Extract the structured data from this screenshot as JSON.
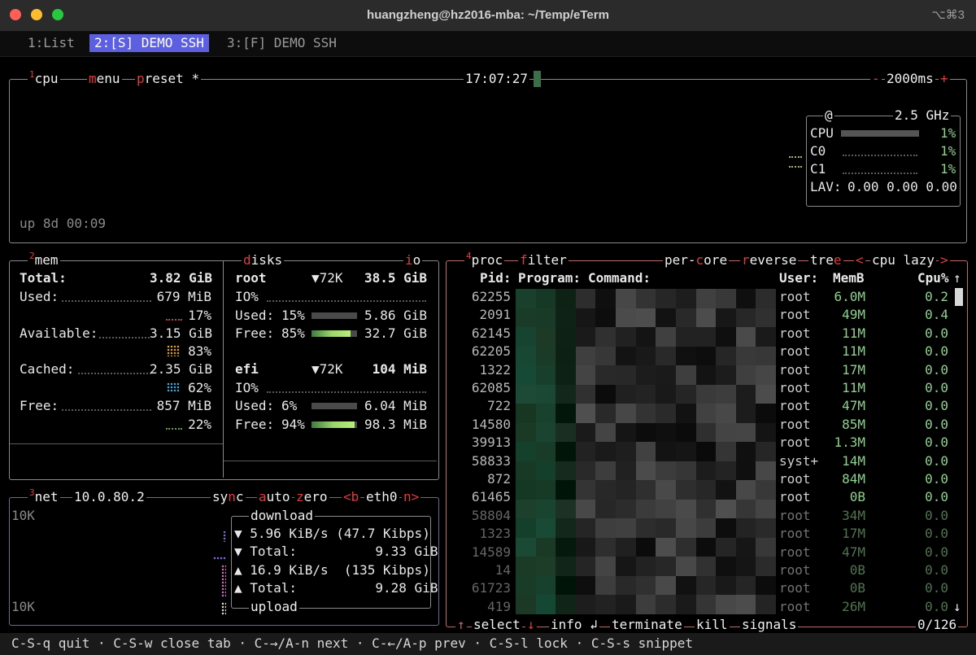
{
  "window": {
    "title": "huangzheng@hz2016-mba: ~/Temp/eTerm",
    "shortcut": "⌥⌘3"
  },
  "tabs": [
    {
      "label": "1:List",
      "active": false
    },
    {
      "label": "2:[S] DEMO SSH",
      "active": true
    },
    {
      "label": "3:[F] DEMO SSH",
      "active": false
    }
  ],
  "cpu": {
    "num": "1",
    "label_rest": "cpu",
    "menu_k": "m",
    "menu_rest": "enu",
    "preset_k": "p",
    "preset_rest": "reset *",
    "clock": "17:07:27",
    "minus": "-",
    "interval": "2000ms",
    "plus": "+",
    "freq_at": "@",
    "freq": "2.5 GHz",
    "rows": [
      {
        "label": "CPU",
        "pct": "1%",
        "level": 0.01
      },
      {
        "label": "C0",
        "pct": "1%",
        "level": 0.01
      },
      {
        "label": "C1",
        "pct": "1%",
        "level": 0.01
      }
    ],
    "lav_label": "LAV:",
    "lav": "0.00 0.00 0.00",
    "uptime": "up 8d 00:09"
  },
  "mem": {
    "num": "2",
    "label": "mem",
    "total_label": "Total:",
    "total": "3.82 GiB",
    "used_label": "Used:",
    "used": "679 MiB",
    "used_pct": "17%",
    "avail_label": "Available:",
    "avail": "3.15 GiB",
    "avail_pct": "83%",
    "cached_label": "Cached:",
    "cached": "2.35 GiB",
    "cached_pct": "62%",
    "free_label": "Free:",
    "free": "857 MiB",
    "free_pct": "22%"
  },
  "disks": {
    "label_k": "d",
    "label_rest": "isks",
    "io_k": "i",
    "io_rest": "o",
    "items": [
      {
        "name": "root",
        "rate": "▼72K",
        "size": "38.5 GiB",
        "io": "IO%",
        "used_label": "Used:",
        "used_pct": "15%",
        "used": "5.86 GiB",
        "used_level": 0.15,
        "free_label": "Free:",
        "free_pct": "85%",
        "free": "32.7 GiB",
        "free_level": 0.85
      },
      {
        "name": "efi",
        "rate": "▼72K",
        "size": "104 MiB",
        "io": "IO%",
        "used_label": "Used:",
        "used_pct": "6%",
        "used": "6.04 MiB",
        "used_level": 0.06,
        "free_label": "Free:",
        "free_pct": "94%",
        "free": "98.3 MiB",
        "free_level": 0.94
      }
    ]
  },
  "net": {
    "num": "3",
    "label": "net",
    "ip": "10.0.80.2",
    "sync_pre": "sy",
    "sync_k": "n",
    "sync_post": "c",
    "auto_k": "a",
    "auto_rest": "uto",
    "zero_k": "z",
    "zero_rest": "ero",
    "iface_prev": "<b",
    "iface": "eth0",
    "iface_next": "n>",
    "scale_top": "10K",
    "scale_bottom": "10K",
    "download_title": "download",
    "upload_title": "upload",
    "down_rate": "▼ 5.96 KiB/s (47.7 Kibps)",
    "down_total": "▼ Total:          9.33 GiB",
    "up_rate": "▲ 16.9 KiB/s  (135 Kibps)",
    "up_total": "▲ Total:          9.28 GiB"
  },
  "proc": {
    "num": "4",
    "label": "proc",
    "filter_k": "f",
    "filter_rest": "ilter",
    "percore_pre": "per-",
    "percore_k": "c",
    "percore_post": "ore",
    "reverse_k": "r",
    "reverse_rest": "everse",
    "tree_pre": "tre",
    "tree_k": "e",
    "sort_prev": "<",
    "sort": "cpu lazy",
    "sort_next": ">",
    "headers": {
      "pid": "Pid:",
      "program": "Program:",
      "command": "Command:",
      "user": "User:",
      "mem": "MemB",
      "cpu": "Cpu%"
    },
    "rows": [
      {
        "pid": "62255",
        "user": "root",
        "mem": "6.0M",
        "cpu": "0.2"
      },
      {
        "pid": "2091",
        "user": "root",
        "mem": "49M",
        "cpu": "0.4"
      },
      {
        "pid": "62145",
        "user": "root",
        "mem": "11M",
        "cpu": "0.0"
      },
      {
        "pid": "62205",
        "user": "root",
        "mem": "11M",
        "cpu": "0.0"
      },
      {
        "pid": "1322",
        "user": "root",
        "mem": "17M",
        "cpu": "0.0"
      },
      {
        "pid": "62085",
        "user": "root",
        "mem": "11M",
        "cpu": "0.0"
      },
      {
        "pid": "722",
        "user": "root",
        "mem": "47M",
        "cpu": "0.0"
      },
      {
        "pid": "14580",
        "user": "root",
        "mem": "85M",
        "cpu": "0.0"
      },
      {
        "pid": "39913",
        "user": "root",
        "mem": "1.3M",
        "cpu": "0.0"
      },
      {
        "pid": "58833",
        "user": "syst+",
        "mem": "14M",
        "cpu": "0.0"
      },
      {
        "pid": "872",
        "user": "root",
        "mem": "84M",
        "cpu": "0.0"
      },
      {
        "pid": "61465",
        "user": "root",
        "mem": "0B",
        "cpu": "0.0"
      },
      {
        "pid": "58804",
        "user": "root",
        "mem": "34M",
        "cpu": "0.0"
      },
      {
        "pid": "1323",
        "user": "root",
        "mem": "17M",
        "cpu": "0.0"
      },
      {
        "pid": "14589",
        "user": "root",
        "mem": "47M",
        "cpu": "0.0"
      },
      {
        "pid": "14",
        "user": "root",
        "mem": "0B",
        "cpu": "0.0"
      },
      {
        "pid": "61723",
        "user": "root",
        "mem": "0B",
        "cpu": "0.0"
      },
      {
        "pid": "419",
        "user": "root",
        "mem": "26M",
        "cpu": "0.0"
      }
    ],
    "scroll_up": "↑",
    "scroll_down": "↓",
    "footer": {
      "select_up": "↑",
      "select": "select",
      "select_down": "↓",
      "info": "info",
      "info_icon": "↲",
      "terminate": "terminate",
      "kill": "kill",
      "signals": "signals",
      "count": "0/126"
    }
  },
  "status": {
    "text": "C-S-q quit · C-S-w close tab · C-→/A-n next · C-←/A-p prev · C-S-l lock · C-S-s snippet"
  },
  "colors": {
    "accent": "#5b5fe0",
    "hotkey": "#e03c3c",
    "good": "#8ed18e"
  }
}
